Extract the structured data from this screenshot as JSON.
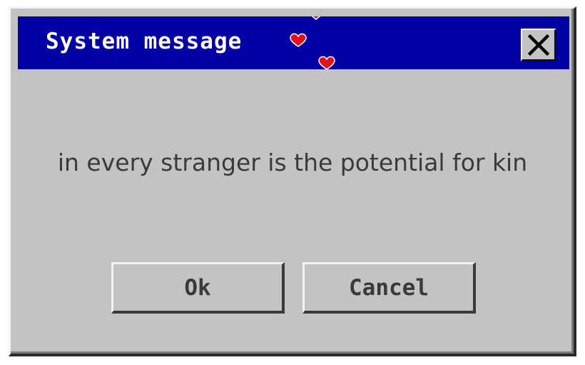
{
  "dialog": {
    "title": "System message",
    "message": "in every stranger is the potential for kin",
    "buttons": {
      "ok_label": "Ok",
      "cancel_label": "Cancel"
    },
    "close_icon": "close-x-icon",
    "decoration_icon": "hearts-icon"
  },
  "colors": {
    "titlebar": "#0000a4",
    "title_text": "#ffffff",
    "face": "#c3c3c3",
    "text": "#3a3a3a",
    "heart": "#e0121a"
  }
}
